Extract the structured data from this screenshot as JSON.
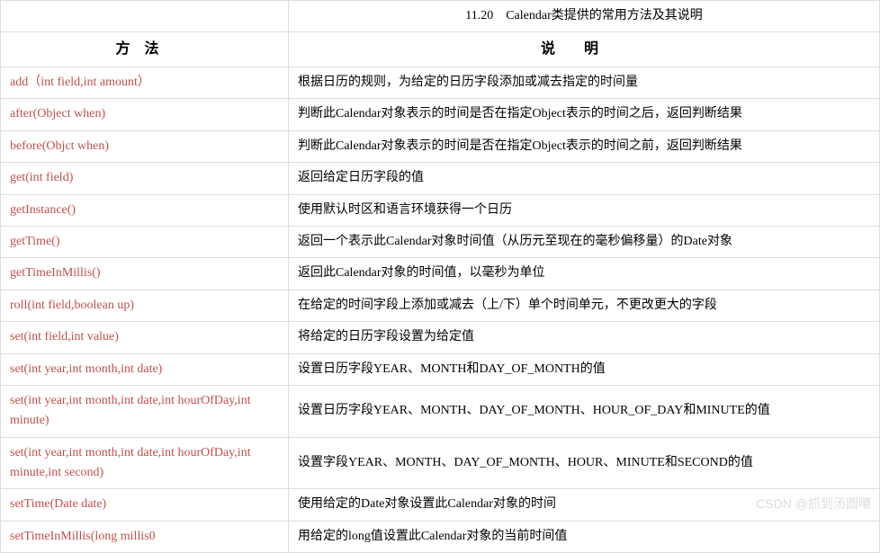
{
  "caption": "11.20　Calendar类提供的常用方法及其说明",
  "headers": {
    "method": "方法",
    "description": "说明"
  },
  "rows": [
    {
      "method": "add（int field,int amount）",
      "description": "根据日历的规则，为给定的日历字段添加或减去指定的时间量"
    },
    {
      "method": "after(Object when)",
      "description": "判断此Calendar对象表示的时间是否在指定Object表示的时间之后，返回判断结果"
    },
    {
      "method": "before(Objct when)",
      "description": "判断此Calendar对象表示的时间是否在指定Object表示的时间之前，返回判断结果"
    },
    {
      "method": "get(int field)",
      "description": "返回给定日历字段的值"
    },
    {
      "method": "getInstance()",
      "description": "使用默认时区和语言环境获得一个日历"
    },
    {
      "method": "getTime()",
      "description": "返回一个表示此Calendar对象时间值（从历元至现在的毫秒偏移量）的Date对象"
    },
    {
      "method": "getTimeInMillis()",
      "description": "返回此Calendar对象的时间值，以毫秒为单位"
    },
    {
      "method": "roll(int field,boolean up)",
      "description": "在给定的时间字段上添加或减去（上/下）单个时间单元，不更改更大的字段"
    },
    {
      "method": "set(int field,int value)",
      "description": "将给定的日历字段设置为给定值"
    },
    {
      "method": "set(int year,int month,int date)",
      "description": "设置日历字段YEAR、MONTH和DAY_OF_MONTH的值"
    },
    {
      "method": "set(int year,int month,int date,int hourOfDay,int minute)",
      "description": "设置日历字段YEAR、MONTH、DAY_OF_MONTH、HOUR_OF_DAY和MINUTE的值"
    },
    {
      "method": "set(int year,int month,int date,int hourOfDay,int minute,int second)",
      "description": "设置字段YEAR、MONTH、DAY_OF_MONTH、HOUR、MINUTE和SECOND的值"
    },
    {
      "method": "setTime(Date date)",
      "description": "使用给定的Date对象设置此Calendar对象的时间"
    },
    {
      "method": "setTimeInMillis(long millis0",
      "description": "用给定的long值设置此Calendar对象的当前时间值"
    }
  ],
  "watermark": "CSDN @抓到汤圆嘈"
}
